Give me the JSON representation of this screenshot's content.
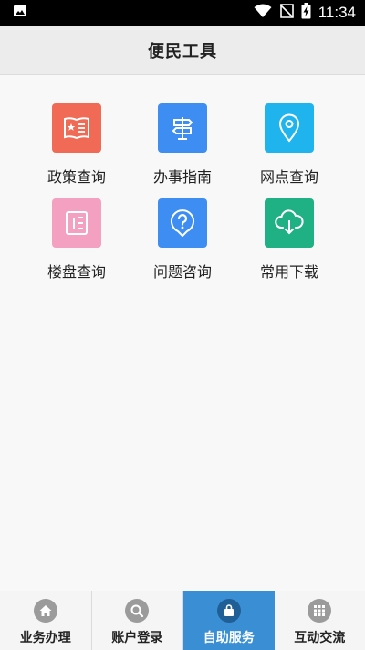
{
  "status_bar": {
    "time": "11:34",
    "left_icons": [
      "image-icon"
    ],
    "right_icons": [
      "wifi-icon",
      "no-sim-icon",
      "battery-charging-icon"
    ]
  },
  "header": {
    "title": "便民工具"
  },
  "tools": [
    {
      "label": "政策查询",
      "icon": "policy-book-icon",
      "color": "#f06a55"
    },
    {
      "label": "办事指南",
      "icon": "signpost-icon",
      "color": "#3d8df2"
    },
    {
      "label": "网点查询",
      "icon": "location-pin-icon",
      "color": "#1fb4ee"
    },
    {
      "label": "楼盘查询",
      "icon": "building-icon",
      "color": "#f4a0c0"
    },
    {
      "label": "问题咨询",
      "icon": "question-bubble-icon",
      "color": "#3d8df2"
    },
    {
      "label": "常用下载",
      "icon": "cloud-download-icon",
      "color": "#1fb083"
    }
  ],
  "bottom_nav": {
    "active_index": 2,
    "active_color": "#3a8fd4",
    "items": [
      {
        "label": "业务办理",
        "icon": "home-icon"
      },
      {
        "label": "账户登录",
        "icon": "search-icon"
      },
      {
        "label": "自助服务",
        "icon": "bag-icon"
      },
      {
        "label": "互动交流",
        "icon": "grid-icon"
      }
    ]
  }
}
